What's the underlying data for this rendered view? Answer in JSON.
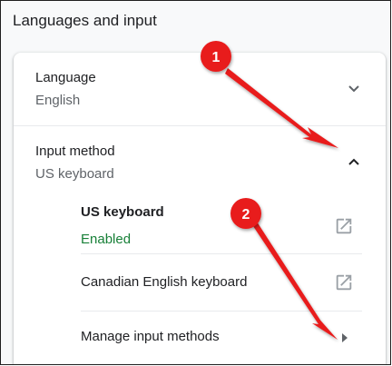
{
  "section": {
    "title": "Languages and input"
  },
  "language": {
    "label": "Language",
    "value": "English"
  },
  "input_method": {
    "label": "Input method",
    "value": "US keyboard",
    "keyboards": [
      {
        "name": "US keyboard",
        "status": "Enabled"
      },
      {
        "name": "Canadian English keyboard"
      }
    ],
    "manage_label": "Manage input methods"
  },
  "annotations": {
    "badge_1": "1",
    "badge_2": "2",
    "color": "#e81c1c"
  },
  "icons": {
    "language_expand": "chevron-down-icon",
    "input_collapse": "chevron-up-icon",
    "open_external": "open-in-new-icon",
    "submenu": "arrow-right-icon"
  }
}
